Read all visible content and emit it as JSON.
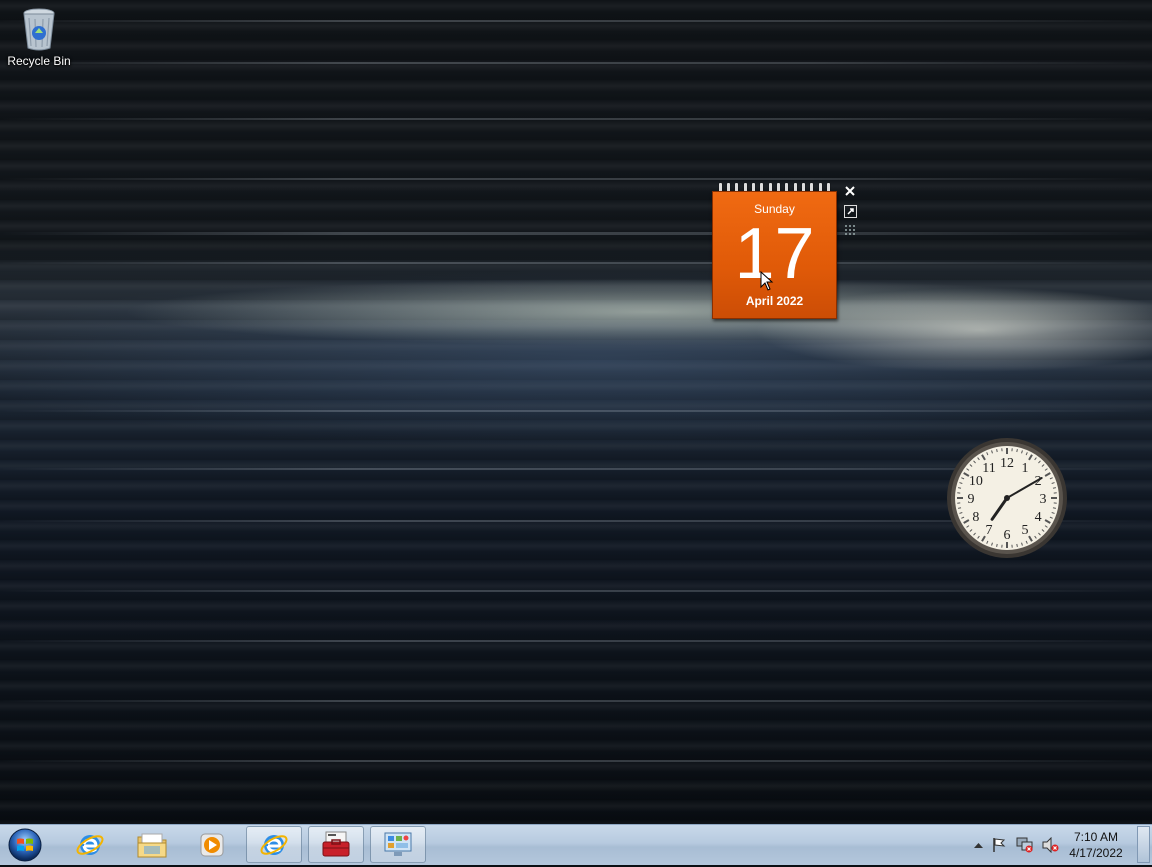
{
  "desktop": {
    "icons": [
      {
        "label": "Recycle Bin",
        "icon": "recycle-bin-icon"
      }
    ]
  },
  "calendar_gadget": {
    "day_name": "Sunday",
    "day_number": "17",
    "month_year": "April 2022",
    "accent_color": "#e8600c"
  },
  "clock_gadget": {
    "numerals": [
      "12",
      "1",
      "2",
      "3",
      "4",
      "5",
      "6",
      "7",
      "8",
      "9",
      "10",
      "11"
    ],
    "time_shown": "7:10"
  },
  "taskbar": {
    "start_icon": "windows-start-orb",
    "pinned": [
      {
        "name": "internet-explorer",
        "icon": "ie-icon"
      },
      {
        "name": "windows-explorer",
        "icon": "folder-icon"
      },
      {
        "name": "media-player",
        "icon": "media-player-icon"
      }
    ],
    "running": [
      {
        "name": "internet-explorer-window",
        "icon": "ie-icon"
      },
      {
        "name": "toolbox-window",
        "icon": "toolbox-icon"
      },
      {
        "name": "control-panel-window",
        "icon": "control-panel-icon"
      }
    ],
    "tray": {
      "time": "7:10 AM",
      "date": "4/17/2022"
    }
  }
}
